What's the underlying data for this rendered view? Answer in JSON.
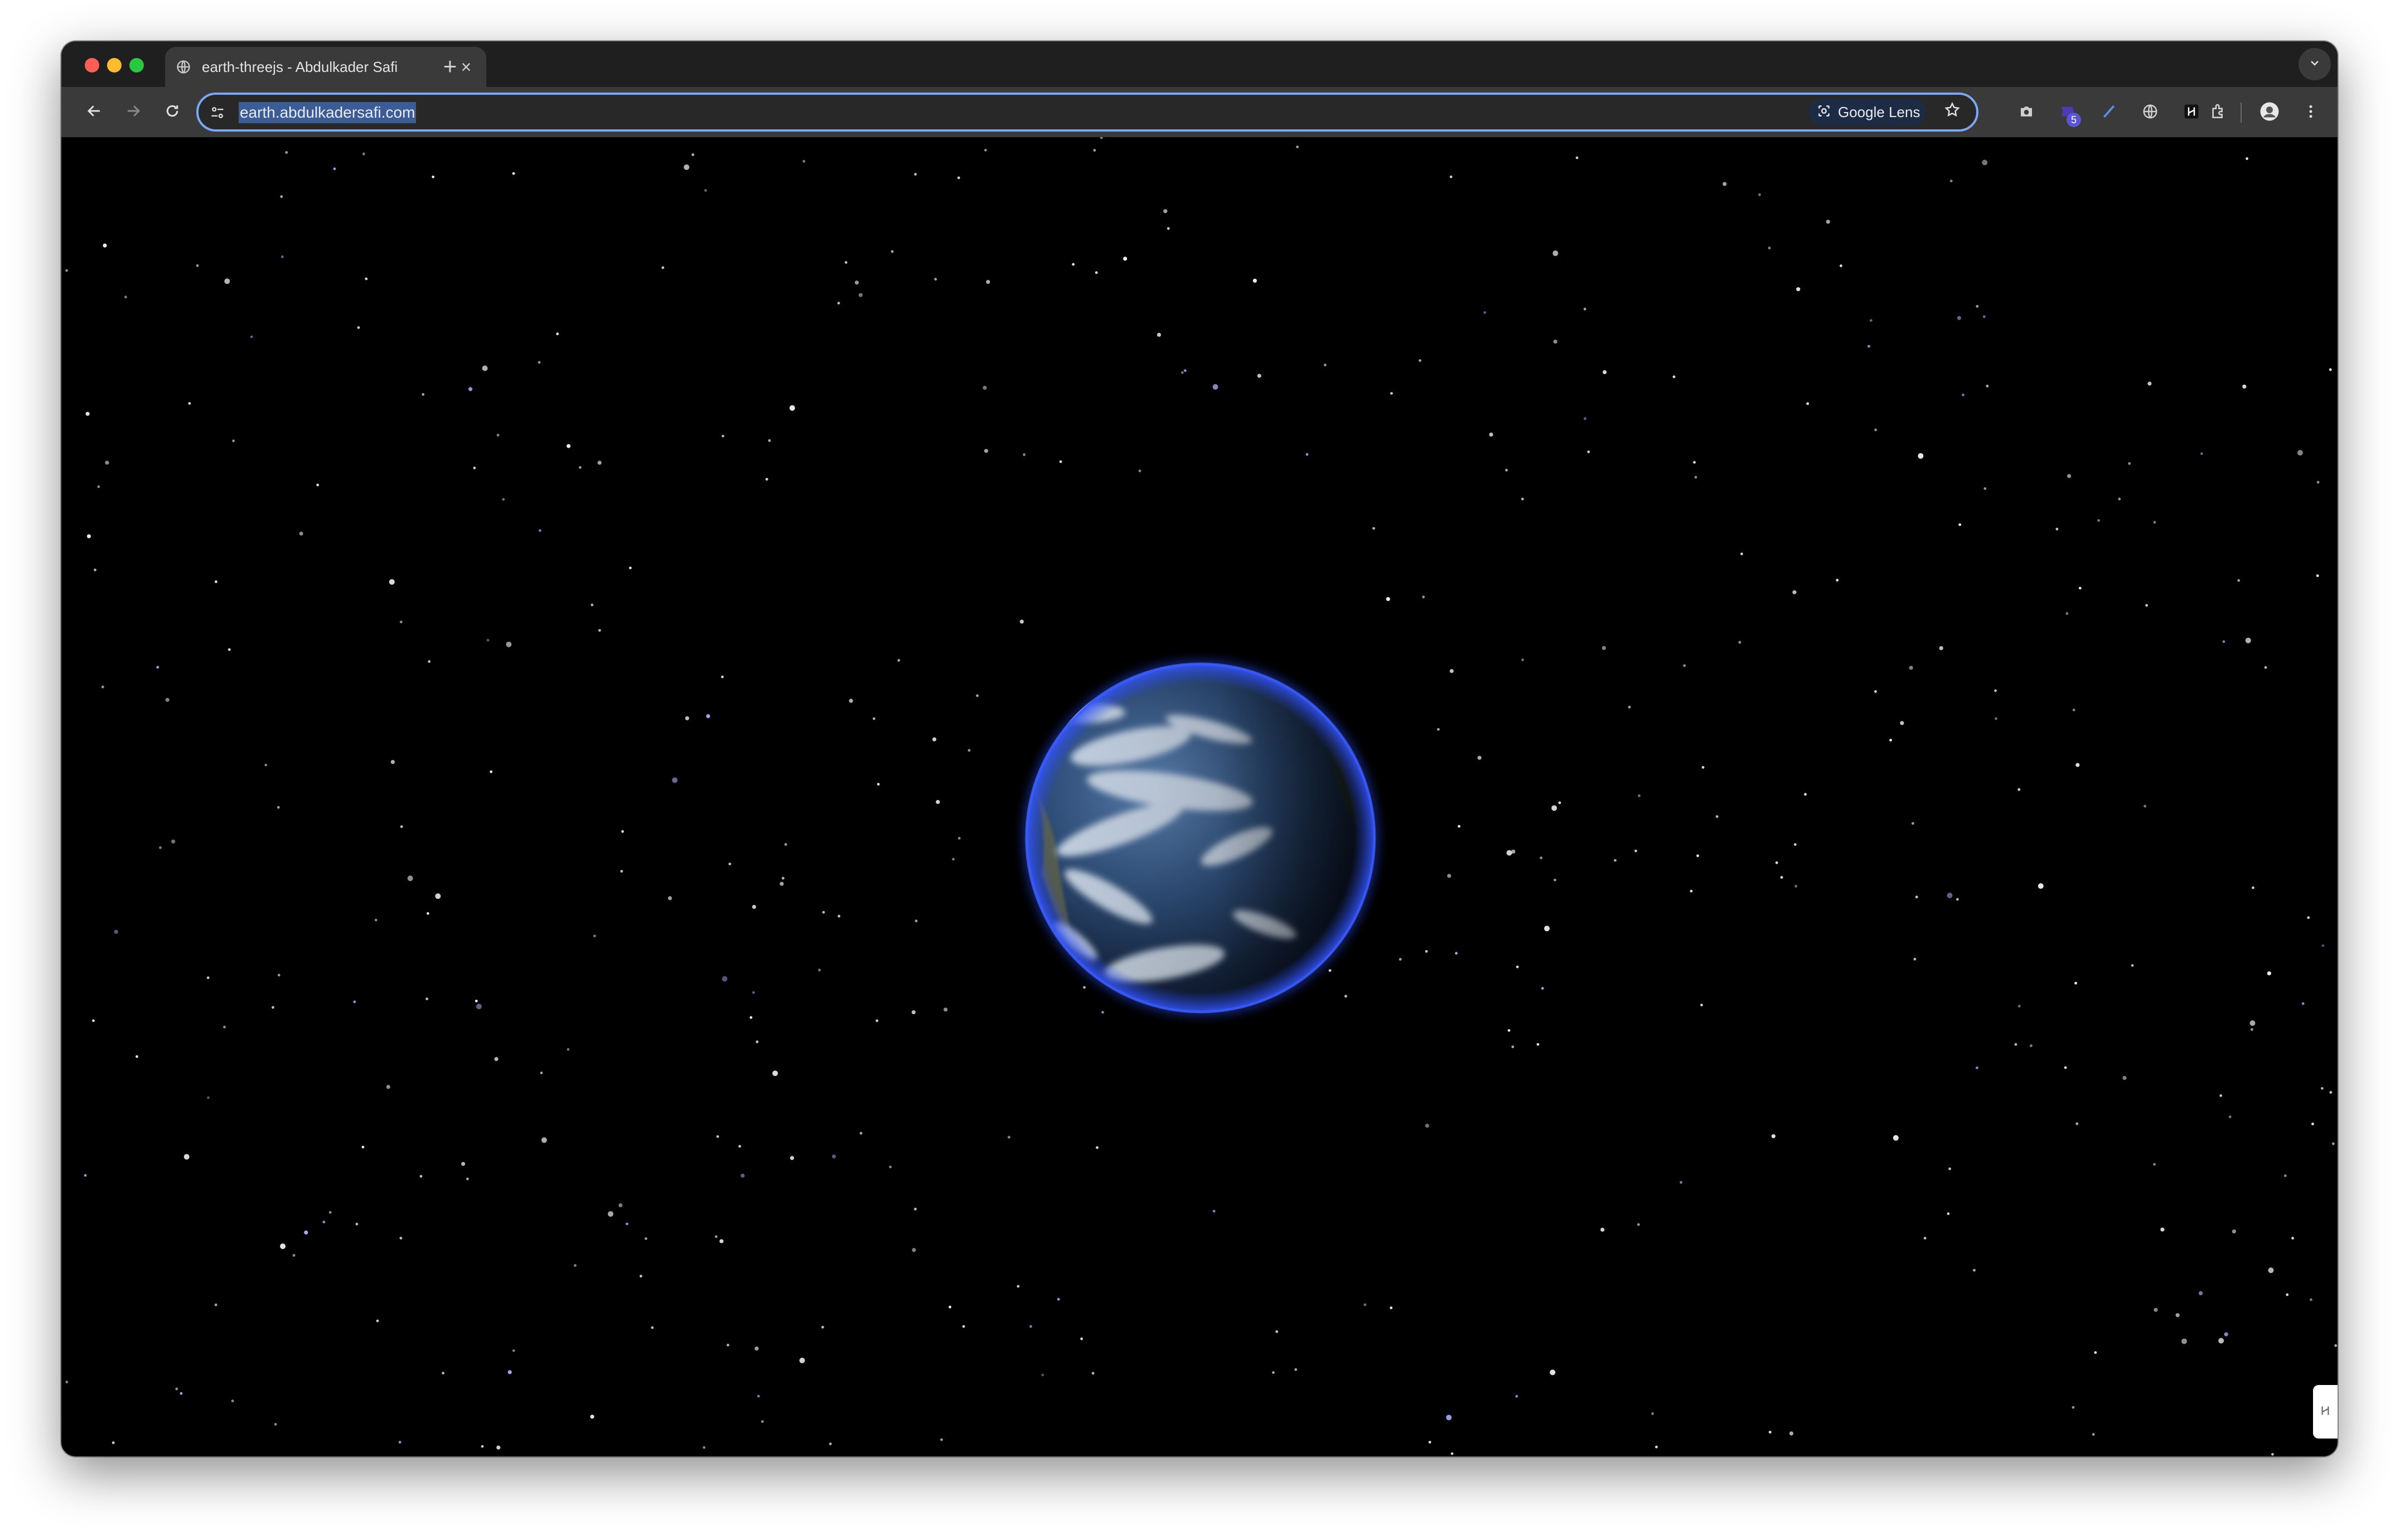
{
  "browser": {
    "tab": {
      "title": "earth-threejs - Abdulkader Safi",
      "favicon": "globe-icon",
      "close": "×"
    },
    "new_tab_label": "+",
    "address_bar": {
      "url": "earth.abdulkadersafi.com"
    },
    "google_lens_label": "Google Lens",
    "extensions": [
      {
        "icon": "camera-icon"
      },
      {
        "icon": "puzzle-badge-icon",
        "badge": "5"
      },
      {
        "icon": "pen-icon"
      },
      {
        "icon": "globe-icon"
      },
      {
        "icon": "h-logo-icon"
      },
      {
        "icon": "extensions-icon"
      }
    ],
    "colors": {
      "accent": "#7ca7f4",
      "tab_bg": "#3a3a3a",
      "tabstrip_bg": "#1f1f1f"
    }
  },
  "page": {
    "scene": "earth-globe",
    "background_color": "#000000",
    "globe_glow_color": "#2846e6"
  }
}
